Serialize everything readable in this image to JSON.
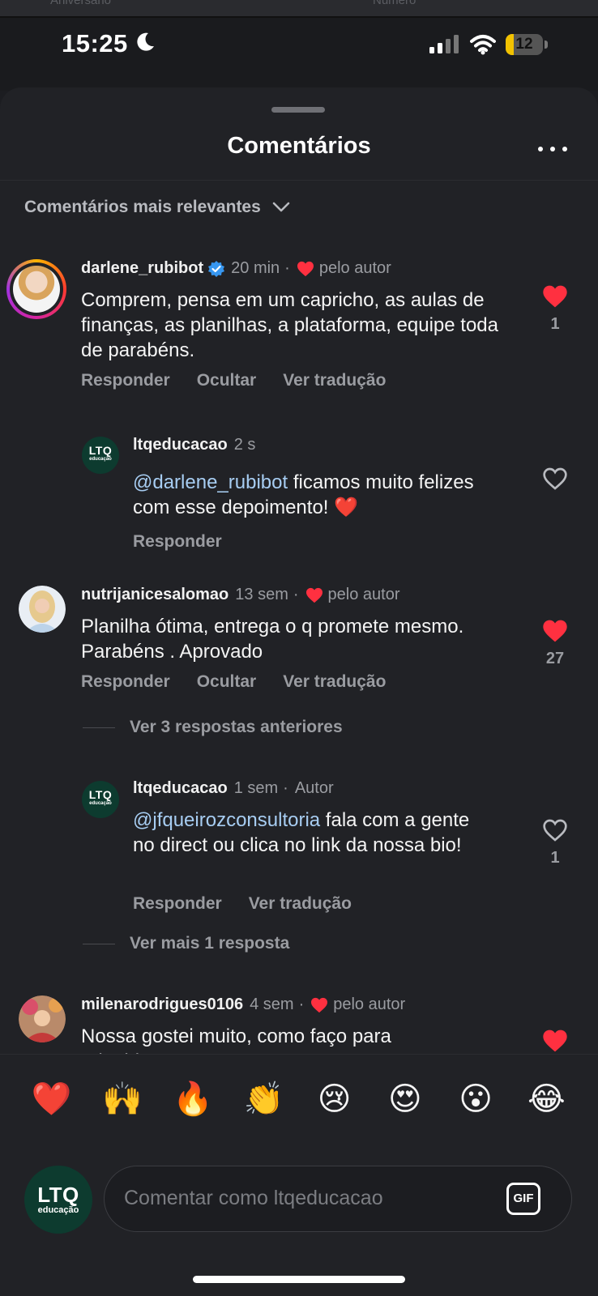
{
  "status_bar": {
    "time": "15:25",
    "battery": "12",
    "battery_level_percent": 12,
    "behind_page_labels": [
      "Aniversário",
      "Número"
    ]
  },
  "sheet": {
    "title": "Comentários",
    "sort_label": "Comentários mais relevantes"
  },
  "comments": [
    {
      "user": "darlene_rubibot",
      "verified": true,
      "time": "20 min",
      "liked_by_author": "pelo autor",
      "text": "Comprem, pensa em um capricho, as aulas de finanças, as planilhas, a plataforma, equipe toda de parabéns.",
      "actions": [
        "Responder",
        "Ocultar",
        "Ver tradução"
      ],
      "likes": "1",
      "liked": true,
      "reply": {
        "user": "ltqeducacao",
        "time": "2 s",
        "mention": "@darlene_rubibot",
        "text": " ficamos muito felizes com esse depoimento! ❤️",
        "actions": [
          "Responder"
        ],
        "liked": false
      }
    },
    {
      "user": "nutrijanicesalomao",
      "time": "13 sem",
      "liked_by_author": "pelo autor",
      "text": "Planilha ótima, entrega o q promete mesmo. Parabéns . Aprovado",
      "actions": [
        "Responder",
        "Ocultar",
        "Ver tradução"
      ],
      "likes": "27",
      "liked": true,
      "previous_replies": "Ver 3 respostas anteriores",
      "reply": {
        "user": "ltqeducacao",
        "time": "1 sem",
        "author_tag": "Autor",
        "mention": "@jfqueirozconsultoria",
        "text": " fala com a gente no direct ou clica no link da nossa bio!",
        "actions": [
          "Responder",
          "Ver tradução"
        ],
        "likes": "1",
        "liked": false
      },
      "more_replies": "Ver mais 1 resposta"
    },
    {
      "user": "milenarodrigues0106",
      "time": "4 sem",
      "liked_by_author": "pelo autor",
      "text": "Nossa gostei muito, como faço para adquirir",
      "liked": true
    }
  ],
  "emoji_bar": [
    "❤️",
    "🙌",
    "🔥",
    "👏",
    "😢",
    "😍",
    "😮",
    "😂"
  ],
  "brand_avatar": {
    "big": "LTQ",
    "small": "educação"
  },
  "composer": {
    "placeholder": "Comentar como ltqeducacao",
    "gif_label": "GIF"
  },
  "colors": {
    "background": "#212226",
    "like_red": "#ff3040",
    "mention_blue": "#a7cdf2",
    "verified_blue": "#3797f0",
    "brand_green": "#0d3b2f"
  }
}
